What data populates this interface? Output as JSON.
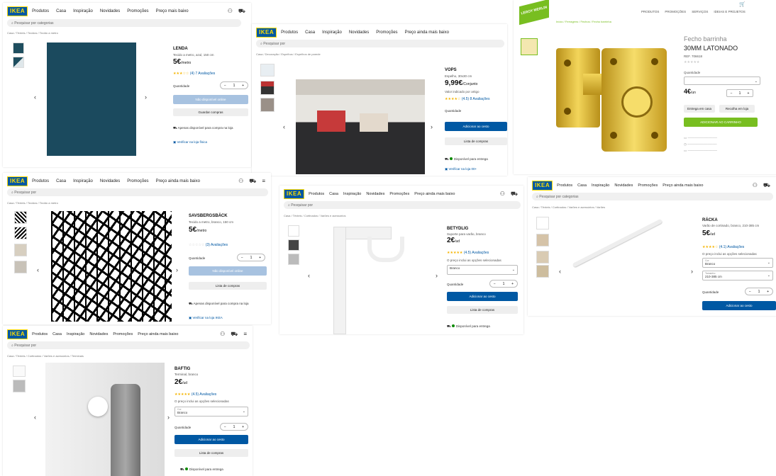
{
  "ikea_nav": [
    "Produtos",
    "Casa",
    "Inspiração",
    "Novidades",
    "Promoções",
    "Preço mais baixo"
  ],
  "ikea_nav_alt": [
    "Produtos",
    "Casa",
    "Inspiração",
    "Novidades",
    "Promoções",
    "Preço ainda mais baixo"
  ],
  "search_placeholder": "Pesquisar por categorias",
  "search_short": "Pesquisar por",
  "lenda": {
    "name": "LENDA",
    "desc": "Tecido a metro, azul, 150 cm",
    "price": "5€",
    "unit": "/metro",
    "reviews": "(4) 7 Avaliações",
    "qty_label": "Quantidade",
    "qty_value": "1",
    "add_button": "Não disponível online",
    "list_button": "Guardar compras",
    "availability": "Apenas disponível para compra na loja",
    "stores": "Verificar na loja física"
  },
  "vops": {
    "name": "VOPS",
    "desc": "Espelho, 30x30 cm",
    "price": "9,99€",
    "unit": "/Conjunto",
    "note": "Valor indicado por artigo",
    "reviews": "(4.5) 8 Avaliações",
    "qty_label": "Quantidade",
    "add_button": "Adicionar ao cesto",
    "list_button": "Lista de compras",
    "availability": "Disponível para entrega",
    "stores": "Verificar na loja 00+"
  },
  "leroy": {
    "logo": "LEROY MERLIN",
    "title": "Fecho barrinha",
    "subtitle": "30MM LATONADO",
    "ref": "REF. 706618",
    "qty_label": "Quantidade",
    "price": "4€",
    "unit": "/un",
    "add_button": "ADICIONAR AO CARRINHO",
    "top_links": [
      "PRODUTOS",
      "PROMOÇÕES",
      "SERVIÇOS",
      "IDEIAS E PROJETOS"
    ],
    "delivery": "Entrega em casa",
    "pickup": "Recolha em loja"
  },
  "sanderson": {
    "name": "SAVSBERGSBÄCK",
    "desc": "Tecido a metro, branco, 150 cm",
    "price": "5€",
    "unit": "/metro",
    "reviews": "(3) Avaliações",
    "qty_label": "Quantidade",
    "add_button": "Não disponível online",
    "list_button": "Lista de compras",
    "availability": "Apenas disponível para compra na loja",
    "stores": "Verificar na loja IKEA"
  },
  "betydlig": {
    "name": "BETYDLIG",
    "desc": "Suporte para varão, branco",
    "price": "2€",
    "unit": "/ud",
    "reviews": "(4.5) Avaliações",
    "note": "O preço inclui as opções selecionadas",
    "select_label": "Branco",
    "qty_label": "Quantidade",
    "add_button": "Adicionar ao cesto",
    "list_button": "Lista de compras",
    "availability": "Disponível para entrega"
  },
  "raeka": {
    "name": "RÄCKA",
    "desc": "Varão de cortinado, branco, 210-385 cm",
    "price": "5€",
    "unit": "/ud",
    "reviews": "(4.1) Avaliações",
    "note": "O preço inclui as opções selecionadas",
    "select1_label": "Cor",
    "select1_value": "Branco",
    "select2_label": "Tamanho",
    "select2_value": "210-385 cm",
    "qty_label": "Quantidade",
    "add_button": "Adicionar ao cesto"
  },
  "baftig": {
    "name": "BAFTIG",
    "desc": "Terminal, branco",
    "price": "2€",
    "unit": "/ud",
    "reviews": "(4.5) Avaliações",
    "note": "O preço inclui as opções selecionadas",
    "select_label": "Cor",
    "select_value": "Branco",
    "qty_label": "Quantidade",
    "add_button": "Adicionar ao cesto",
    "list_button": "Lista de compras",
    "availability": "Disponível para entrega"
  }
}
